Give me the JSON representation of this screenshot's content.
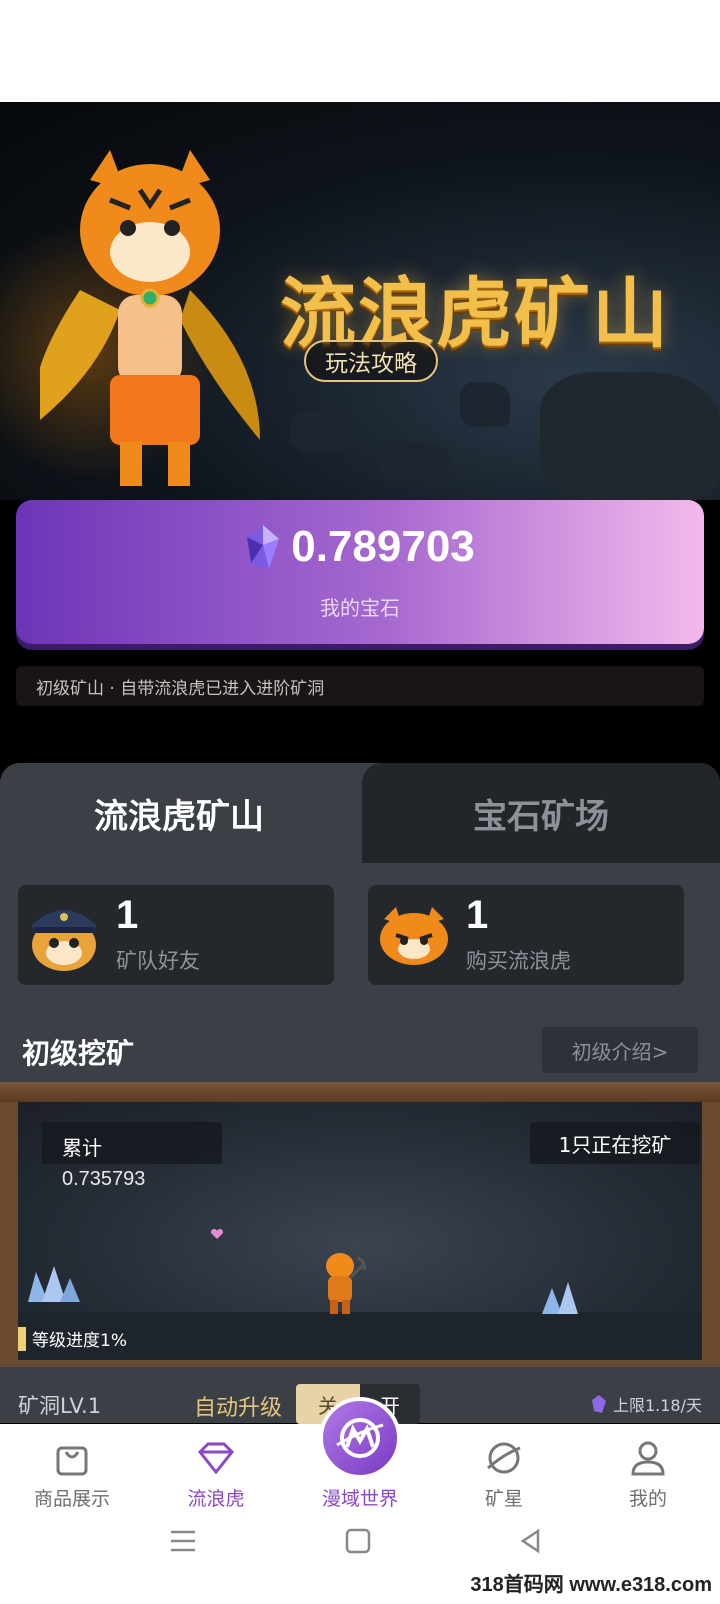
{
  "banner": {
    "title": "流浪虎矿山",
    "guide_button": "玩法攻略"
  },
  "gem": {
    "value": "0.789703",
    "label": "我的宝石"
  },
  "notice": "初级矿山 · 自带流浪虎已进入进阶矿洞",
  "tabs": [
    {
      "label": "流浪虎矿山",
      "active": true
    },
    {
      "label": "宝石矿场",
      "active": false
    }
  ],
  "stats": [
    {
      "value": "1",
      "label": "矿队好友"
    },
    {
      "value": "1",
      "label": "购买流浪虎"
    }
  ],
  "section": {
    "title": "初级挖矿",
    "intro_button": "初级介绍>"
  },
  "mine": {
    "accumulated_label": "累计",
    "accumulated_value": "0.735793",
    "mining_status": "1只正在挖矿",
    "progress_text": "等级进度1%",
    "progress_percent": 1
  },
  "level": {
    "cave": "矿洞LV.1",
    "auto_upgrade": "自动升级",
    "toggle_off": "关",
    "toggle_on": "开",
    "limit": "上限1.18/天"
  },
  "nav": [
    {
      "label": "商品展示",
      "icon": "bag-icon",
      "active": false
    },
    {
      "label": "流浪虎",
      "icon": "gem-icon",
      "active": true
    },
    {
      "label": "漫域世界",
      "icon": "planet-icon",
      "active": false
    },
    {
      "label": "矿星",
      "icon": "planet-ring-icon",
      "active": false
    },
    {
      "label": "我的",
      "icon": "user-icon",
      "active": false
    }
  ],
  "watermark": "318首码网 www.e318.com",
  "colors": {
    "accent": "#8a47c8",
    "gold": "#f2c04a",
    "panel": "#3b4047"
  }
}
